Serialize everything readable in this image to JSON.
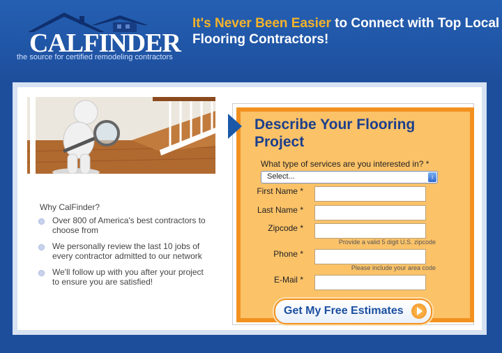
{
  "brand": {
    "logo_text": "CALFINDER",
    "tagline": "the source for certified remodeling contractors"
  },
  "headline": {
    "accent": "It's Never Been Easier",
    "rest": " to Connect with Top Local Flooring Contractors!"
  },
  "why": {
    "title": "Why CalFinder?",
    "items": [
      "Over 800 of America's best contractors to choose from",
      "We personally review the last 10 jobs of every contractor admitted to our network",
      "We'll follow up with you after your project to ensure you are satisfied!"
    ]
  },
  "form": {
    "title": "Describe Your Flooring Project",
    "service_label": "What type of services are you interested in? *",
    "service_selected": "Select...",
    "first_name_label": "First Name",
    "last_name_label": "Last Name",
    "zipcode_label": "Zipcode",
    "zipcode_hint": "Provide a valid 5 digit U.S. zipcode",
    "phone_label": "Phone",
    "phone_hint": "Please include your area code",
    "email_label": "E-Mail",
    "required_mark": "*",
    "first_name_value": "",
    "last_name_value": "",
    "zipcode_value": "",
    "phone_value": "",
    "email_value": "",
    "submit_label": "Get My Free Estimates"
  },
  "colors": {
    "page_blue": "#1d4e9c",
    "accent_orange": "#f5b32a",
    "form_orange": "#f2911f",
    "title_blue": "#1b3f8c"
  }
}
